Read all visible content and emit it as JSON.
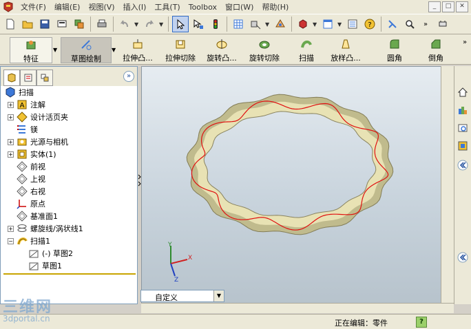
{
  "menubar": {
    "items": [
      "文件(F)",
      "编辑(E)",
      "视图(V)",
      "插入(I)",
      "工具(T)",
      "Toolbox",
      "窗口(W)",
      "帮助(H)"
    ],
    "window_buttons": [
      "_",
      "□",
      "✕"
    ]
  },
  "toolbar": {
    "icons": [
      "new-document",
      "open-folder",
      "save",
      "print-preview",
      "rebuild",
      "print",
      "undo",
      "redo",
      "select-pointer",
      "filter",
      "traffic-light",
      "grid",
      "view-orientation",
      "render",
      "display-style",
      "section",
      "help-question",
      "smart-dim",
      "zoom"
    ]
  },
  "command_manager": {
    "items": [
      {
        "label": "特征"
      },
      {
        "label": "草图绘制"
      },
      {
        "label": "拉伸凸..."
      },
      {
        "label": "拉伸切除"
      },
      {
        "label": "旋转凸..."
      },
      {
        "label": "旋转切除"
      },
      {
        "label": "扫描"
      },
      {
        "label": "放样凸..."
      },
      {
        "label": "圆角"
      },
      {
        "label": "倒角"
      }
    ]
  },
  "feature_tree": {
    "root": "扫描",
    "items": [
      {
        "label": "注解",
        "expander": "+",
        "icon": "annotation-icon"
      },
      {
        "label": "设计活页夹",
        "expander": "+",
        "icon": "binder-icon"
      },
      {
        "label": "镁",
        "expander": "",
        "icon": "material-icon"
      },
      {
        "label": "光源与相机",
        "expander": "+",
        "icon": "lights-camera-icon"
      },
      {
        "label": "实体(1)",
        "expander": "+",
        "icon": "solid-bodies-icon"
      },
      {
        "label": "前视",
        "expander": "",
        "icon": "plane-icon"
      },
      {
        "label": "上视",
        "expander": "",
        "icon": "plane-icon"
      },
      {
        "label": "右视",
        "expander": "",
        "icon": "plane-icon"
      },
      {
        "label": "原点",
        "expander": "",
        "icon": "origin-icon"
      },
      {
        "label": "基准面1",
        "expander": "",
        "icon": "plane-icon"
      },
      {
        "label": "螺旋线/涡状线1",
        "expander": "+",
        "icon": "helix-icon"
      },
      {
        "label": "扫描1",
        "expander": "−",
        "icon": "sweep-icon"
      },
      {
        "label": "(-) 草图2",
        "expander": "",
        "icon": "sketch-icon",
        "indent": 1
      },
      {
        "label": "草图1",
        "expander": "",
        "icon": "sketch-icon",
        "indent": 1
      }
    ]
  },
  "view_select": {
    "value": "自定义"
  },
  "triad": {
    "x": "X",
    "y": "Y",
    "z": "Z"
  },
  "status": {
    "text": "正在编辑：零件",
    "help": "?"
  },
  "watermark": {
    "cn": "三维网",
    "en": "3dportal.cn"
  },
  "colors": {
    "ring": "#e8e2b4",
    "sweep_path": "#e01010",
    "viewport_top": "#e6ecf1",
    "viewport_bottom": "#b7c3cc"
  }
}
